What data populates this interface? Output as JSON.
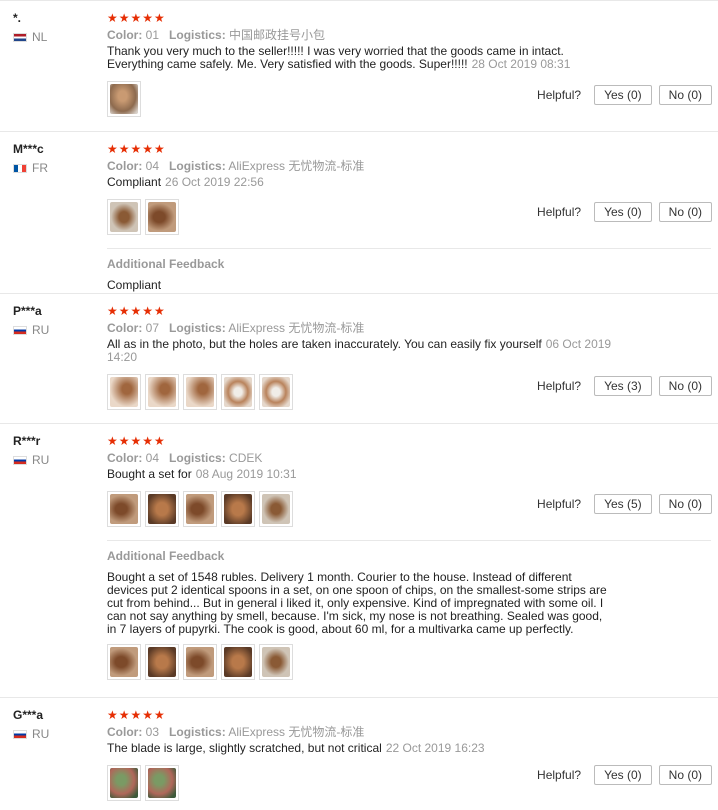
{
  "labels": {
    "color": "Color:",
    "logistics": "Logistics:",
    "helpful": "Helpful?",
    "additional_feedback": "Additional Feedback",
    "stars": "★★★★★"
  },
  "reviews": [
    {
      "user": "*.",
      "country": "NL",
      "rating": 5,
      "color": "01",
      "logistics": "中国邮政挂号小包",
      "text": "Thank you very much to the seller!!!!! I was very worried that the goods came in intact. Everything came safely. Me. Very satisfied with the goods. Super!!!!!",
      "date": "28 Oct 2019 08:31",
      "yes": "Yes (0)",
      "no": "No (0)"
    },
    {
      "user": "M***c",
      "country": "FR",
      "rating": 5,
      "color": "04",
      "logistics": "AliExpress 无忧物流-标准",
      "text": "Compliant",
      "date": "26 Oct 2019 22:56",
      "yes": "Yes (0)",
      "no": "No (0)",
      "additional": "Compliant"
    },
    {
      "user": "P***a",
      "country": "RU",
      "rating": 5,
      "color": "07",
      "logistics": "AliExpress 无忧物流-标准",
      "text": "All as in the photo, but the holes are taken inaccurately. You can easily fix yourself",
      "date": "06 Oct 2019 14:20",
      "yes": "Yes (3)",
      "no": "No (0)"
    },
    {
      "user": "R***r",
      "country": "RU",
      "rating": 5,
      "color": "04",
      "logistics": "CDEK",
      "text": "Bought a set for",
      "date": "08 Aug 2019 10:31",
      "yes": "Yes (5)",
      "no": "No (0)",
      "additional": "Bought a set of 1548 rubles. Delivery 1 month. Courier to the house. Instead of different devices put 2 identical spoons in a set, on one spoon of chips, on the smallest-some strips are cut from behind... But in general i liked it, only expensive. Kind of impregnated with some oil. I can not say anything by smell, because. I'm sick, my nose is not breathing. Sealed was good, in 7 layers of pupyrki. The cook is good, about 60 ml, for a multivarka came up perfectly."
    },
    {
      "user": "G***a",
      "country": "RU",
      "rating": 5,
      "color": "03",
      "logistics": "AliExpress 无忧物流-标准",
      "text": "The blade is large, slightly scratched, but not critical",
      "date": "22 Oct 2019 16:23",
      "yes": "Yes (0)",
      "no": "No (0)"
    }
  ]
}
